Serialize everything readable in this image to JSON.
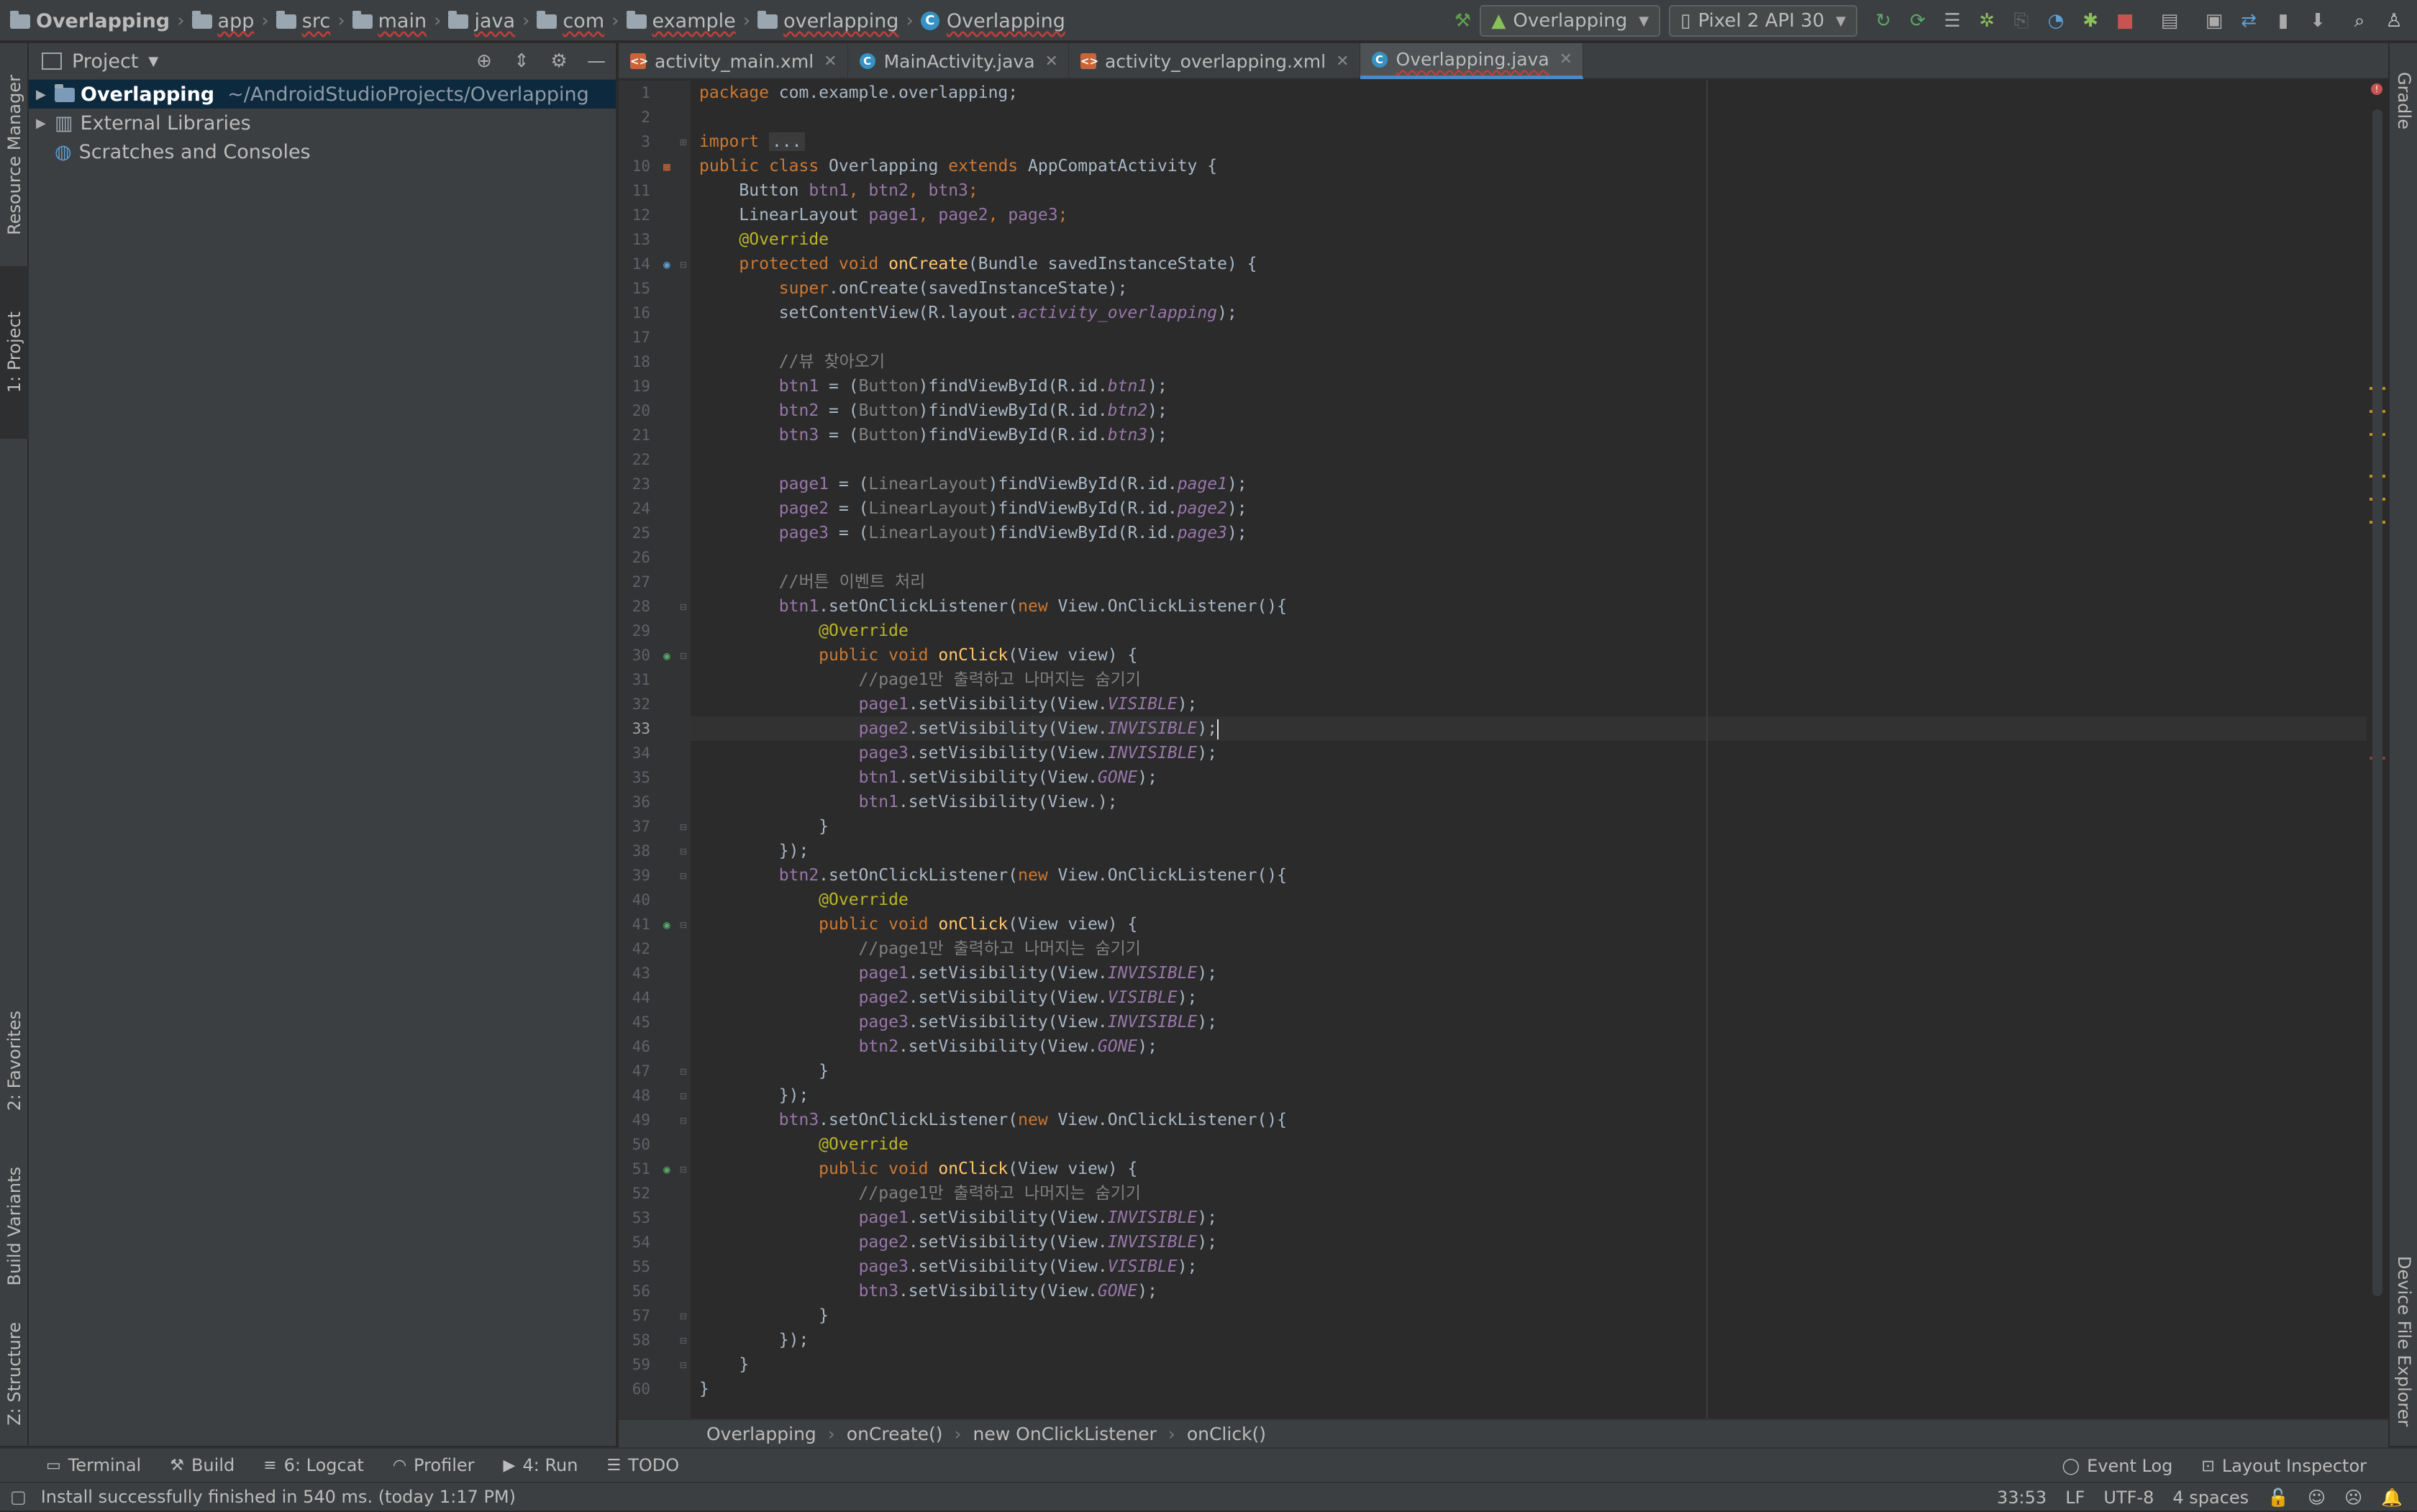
{
  "breadcrumb": [
    "Overlapping",
    "app",
    "src",
    "main",
    "java",
    "com",
    "example",
    "overlapping",
    "Overlapping"
  ],
  "toolbar": {
    "run_config": "Overlapping",
    "device": "Pixel 2 API 30"
  },
  "left_tabs": [
    "Resource Manager",
    "1: Project",
    "2: Favorites",
    "Build Variants",
    "Z: Structure"
  ],
  "right_tabs": [
    "Gradle",
    "Device File Explorer"
  ],
  "project": {
    "title": "Project",
    "tree": [
      {
        "name": "Overlapping",
        "path": "~/AndroidStudioProjects/Overlapping"
      },
      {
        "name": "External Libraries"
      },
      {
        "name": "Scratches and Consoles"
      }
    ]
  },
  "tabs": [
    "activity_main.xml",
    "MainActivity.java",
    "activity_overlapping.xml",
    "Overlapping.java"
  ],
  "gutter": [
    "1",
    "2",
    "3",
    "10",
    "11",
    "12",
    "13",
    "14",
    "15",
    "16",
    "17",
    "18",
    "19",
    "20",
    "21",
    "22",
    "23",
    "24",
    "25",
    "26",
    "27",
    "28",
    "29",
    "30",
    "31",
    "32",
    "33",
    "34",
    "35",
    "36",
    "37",
    "38",
    "39",
    "40",
    "41",
    "42",
    "43",
    "44",
    "45",
    "46",
    "47",
    "48",
    "49",
    "50",
    "51",
    "52",
    "53",
    "54",
    "55",
    "56",
    "57",
    "58",
    "59",
    "60"
  ],
  "code_text": {
    "l1": [
      "package",
      " com.example.overlapping;"
    ],
    "l3a": "import",
    "l3b": "...",
    "l10": [
      "public",
      "class",
      " Overlapping ",
      "extends",
      " AppCompatActivity {"
    ],
    "l11": [
      "    Button ",
      "btn1",
      ", ",
      "btn2",
      ", ",
      "btn3",
      ";"
    ],
    "l12": [
      "    LinearLayout ",
      "page1",
      ", ",
      "page2",
      ", ",
      "page3",
      ";"
    ],
    "l13": "    @Override",
    "l14": [
      "    protected void ",
      "onCreate",
      "(Bundle savedInstanceState) {"
    ],
    "l15": [
      "        ",
      "super",
      ".onCreate(savedInstanceState);"
    ],
    "l16": [
      "        setContentView(R.layout.",
      "activity_overlapping",
      ");"
    ],
    "l18": "        //뷰 찾아오기",
    "l19": [
      "        ",
      "btn1",
      " = (",
      "Button",
      ")findViewById(R.id.",
      "btn1",
      ");"
    ],
    "l20": [
      "        ",
      "btn2",
      " = (",
      "Button",
      ")findViewById(R.id.",
      "btn2",
      ");"
    ],
    "l21": [
      "        ",
      "btn3",
      " = (",
      "Button",
      ")findViewById(R.id.",
      "btn3",
      ");"
    ],
    "l23": [
      "        ",
      "page1",
      " = (",
      "LinearLayout",
      ")findViewById(R.id.",
      "page1",
      ");"
    ],
    "l24": [
      "        ",
      "page2",
      " = (",
      "LinearLayout",
      ")findViewById(R.id.",
      "page2",
      ");"
    ],
    "l25": [
      "        ",
      "page3",
      " = (",
      "LinearLayout",
      ")findViewById(R.id.",
      "page3",
      ");"
    ],
    "l27": "        //버튼 이벤트 처리",
    "l28": [
      "        ",
      "btn1",
      ".setOnClickListener(",
      "new",
      " View.OnClickListener(){"
    ],
    "l29": "            @Override",
    "l30": [
      "            public void ",
      "onClick",
      "(View view) {"
    ],
    "l31": "                //page1만 출력하고 나머지는 숨기기",
    "l32": [
      "                ",
      "page1",
      ".setVisibility(View.",
      "VISIBLE",
      ");"
    ],
    "l33": [
      "                ",
      "page2",
      ".setVisibility(View.",
      "INVISIBLE",
      ");"
    ],
    "l34": [
      "                ",
      "page3",
      ".setVisibility(View.",
      "INVISIBLE",
      ");"
    ],
    "l35": [
      "                ",
      "btn1",
      ".setVisibility(View.",
      "GONE",
      ");"
    ],
    "l36": [
      "                ",
      "btn1",
      ".setVisibility(View.",
      ");"
    ],
    "l37": "            }",
    "l38": "        });",
    "l39": [
      "        ",
      "btn2",
      ".setOnClickListener(",
      "new",
      " View.OnClickListener(){"
    ],
    "l40": "            @Override",
    "l41": [
      "            public void ",
      "onClick",
      "(View view) {"
    ],
    "l42": "                //page1만 출력하고 나머지는 숨기기",
    "l43": [
      "                ",
      "page1",
      ".setVisibility(View.",
      "INVISIBLE",
      ");"
    ],
    "l44": [
      "                ",
      "page2",
      ".setVisibility(View.",
      "VISIBLE",
      ");"
    ],
    "l45": [
      "                ",
      "page3",
      ".setVisibility(View.",
      "INVISIBLE",
      ");"
    ],
    "l46": [
      "                ",
      "btn2",
      ".setVisibility(View.",
      "GONE",
      ");"
    ],
    "l47": "            }",
    "l48": "        });",
    "l49": [
      "        ",
      "btn3",
      ".setOnClickListener(",
      "new",
      " View.OnClickListener(){"
    ],
    "l50": "            @Override",
    "l51": [
      "            public void ",
      "onClick",
      "(View view) {"
    ],
    "l52": "                //page1만 출력하고 나머지는 숨기기",
    "l53": [
      "                ",
      "page1",
      ".setVisibility(View.",
      "INVISIBLE",
      ");"
    ],
    "l54": [
      "                ",
      "page2",
      ".setVisibility(View.",
      "INVISIBLE",
      ");"
    ],
    "l55": [
      "                ",
      "page3",
      ".setVisibility(View.",
      "VISIBLE",
      ");"
    ],
    "l56": [
      "                ",
      "btn3",
      ".setVisibility(View.",
      "GONE",
      ");"
    ],
    "l57": "            }",
    "l58": "        });",
    "l59": "    }",
    "l60": "}"
  },
  "nav_breadcrumb": [
    "Overlapping",
    "onCreate()",
    "new OnClickListener",
    "onClick()"
  ],
  "bottom_tools": [
    "Terminal",
    "Build",
    "6: Logcat",
    "Profiler",
    "4: Run",
    "TODO"
  ],
  "bottom_right_tools": [
    "Event Log",
    "Layout Inspector"
  ],
  "status": {
    "message": "Install successfully finished in 540 ms. (today 1:17 PM)",
    "position": "33:53",
    "line_sep": "LF",
    "encoding": "UTF-8",
    "indent": "4 spaces"
  },
  "colors": {
    "keyword": "#cc7832",
    "annotation": "#bbb529",
    "method": "#ffc66d",
    "field": "#9876aa",
    "comment": "#808080",
    "selection": "#0d293e",
    "tab_underline": "#4a88c7"
  }
}
